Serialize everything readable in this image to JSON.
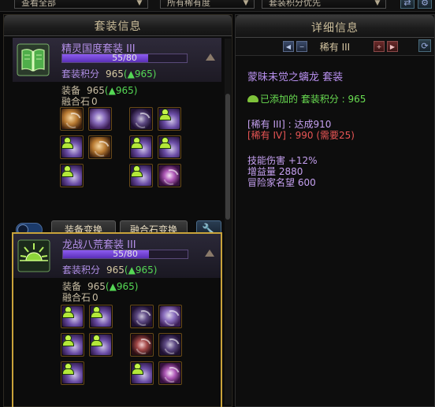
{
  "filters": {
    "view_label": "查看全部",
    "rarity_label": "所有稀有度",
    "priority_label": "套装积分优先"
  },
  "left": {
    "header": "套装信息",
    "sets": [
      {
        "name": "精灵国度套装 III",
        "progress_text": "55/80",
        "progress_value": 0.6875,
        "score_label": "套装积分",
        "score_value": "965",
        "score_change": "(▲965)",
        "equip_label": "装备",
        "equip_value": "965",
        "equip_change": "(▲965)",
        "fusion_label": "融合石",
        "fusion_value": "0",
        "emblem_icon": "open-book-icon"
      },
      {
        "name": "龙战八荒套装 III",
        "progress_text": "55/80",
        "progress_value": 0.6875,
        "score_label": "套装积分",
        "score_value": "965",
        "score_change": "(▲965)",
        "equip_label": "装备",
        "equip_value": "965",
        "equip_change": "(▲965)",
        "fusion_label": "融合石",
        "fusion_value": "0",
        "emblem_icon": "rising-sun-icon"
      }
    ],
    "buttons": {
      "equip_swap": "装备变换",
      "fusion_swap": "融合石变换"
    }
  },
  "right": {
    "header": "详细信息",
    "rarity_label": "稀有 III",
    "set_title": "蒙昧未觉之螭龙 套装",
    "added_label": "已添加的 套装积分 : 965",
    "req_rare3": "[稀有 III] : 达成910",
    "req_rare4": "[稀有 IV] : 990 (需要25)",
    "effects": [
      "技能伤害 +12%",
      "增益量 2880",
      "冒险家名望 600"
    ]
  },
  "colors": {
    "gold_border": "#c9a33a",
    "purple_text": "#b590ea",
    "green_text": "#55d855",
    "red_text": "#e85555"
  }
}
